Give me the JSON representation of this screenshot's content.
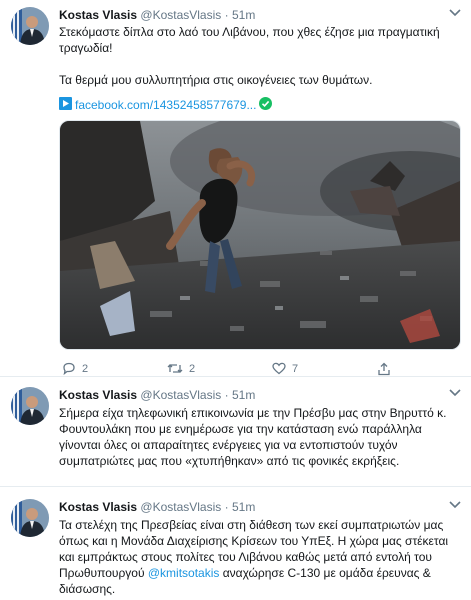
{
  "tweets": [
    {
      "name": "Kostas Vlasis",
      "handle": "@KostasVlasis",
      "dot": "·",
      "time": "51m",
      "lines": [
        "Στεκόμαστε δίπλα στο λαό του Λιβάνου, που χθες έζησε μια πραγματική",
        "τραγωδία!",
        "",
        "Τα θερμά μου συλλυπητήρια στις οικογένειες των θυμάτων."
      ],
      "link_text": "facebook.com/14352458577679...",
      "replies": "2",
      "retweets": "2",
      "likes": "7"
    },
    {
      "name": "Kostas Vlasis",
      "handle": "@KostasVlasis",
      "dot": "·",
      "time": "51m",
      "lines": [
        "Σήμερα είχα τηλεφωνική επικοινωνία με την Πρέσβυ μας στην Βηρυττό κ.",
        "Φουντουλάκη που με ενημέρωσε για την κατάσταση ενώ παράλληλα",
        "γίνονται όλες οι απαραίτητες ενέργειες για να εντοπιστούν τυχόν",
        "συμπατριώτες μας που «χτυπήθηκαν» από τις φονικές εκρήξεις."
      ]
    },
    {
      "name": "Kostas Vlasis",
      "handle": "@KostasVlasis",
      "dot": "·",
      "time": "51m",
      "lines": [
        "Τα στελέχη της Πρεσβείας είναι στη διάθεση των εκεί συμπατριωτών μας",
        "όπως και η Μονάδα Διαχείρισης Κρίσεων του ΥπΕξ. Η χώρα μας στέκεται",
        "και εμπράκτως στους πολίτες του Λιβάνου καθώς μετά από εντολή του"
      ],
      "line4_before": "Πρωθυπουργού ",
      "mention": "@kmitsotakis",
      "line4_after": " αναχώρησε C-130 με ομάδα έρευνας &",
      "line5": "διάσωσης."
    }
  ],
  "colors": {
    "link": "#1b95e0",
    "secondary": "#657786",
    "divider": "#e6ecf0",
    "verified": "#17bf63"
  },
  "icons": [
    "caret-down-icon",
    "facebook-link-icon",
    "verified-check-icon",
    "reply-icon",
    "retweet-icon",
    "like-icon",
    "share-icon"
  ]
}
